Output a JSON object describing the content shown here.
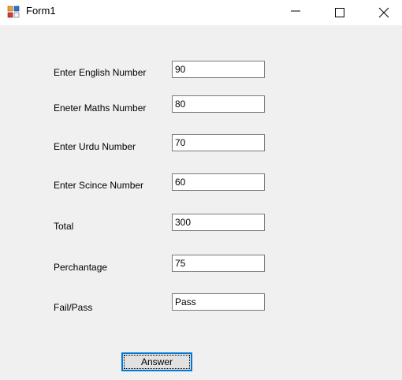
{
  "window": {
    "title": "Form1",
    "icon": "form-icon",
    "controls": [
      "minimize-icon",
      "maximize-icon",
      "close-icon"
    ]
  },
  "form": {
    "fields": [
      {
        "label": "Enter English Number",
        "value": "90"
      },
      {
        "label": "Eneter Maths Number",
        "value": "80"
      },
      {
        "label": "Enter Urdu Number",
        "value": "70"
      },
      {
        "label": "Enter Scince Number",
        "value": "60"
      },
      {
        "label": "Total",
        "value": "300"
      },
      {
        "label": "Perchantage",
        "value": "75"
      },
      {
        "label": "Fail/Pass",
        "value": "Pass"
      }
    ],
    "answer_button": "Answer"
  },
  "colors": {
    "window_bg": "#f0f0f0",
    "titlebar_bg": "#ffffff",
    "textbox_border": "#7a7a7a",
    "button_focus_border": "#0078d7"
  }
}
